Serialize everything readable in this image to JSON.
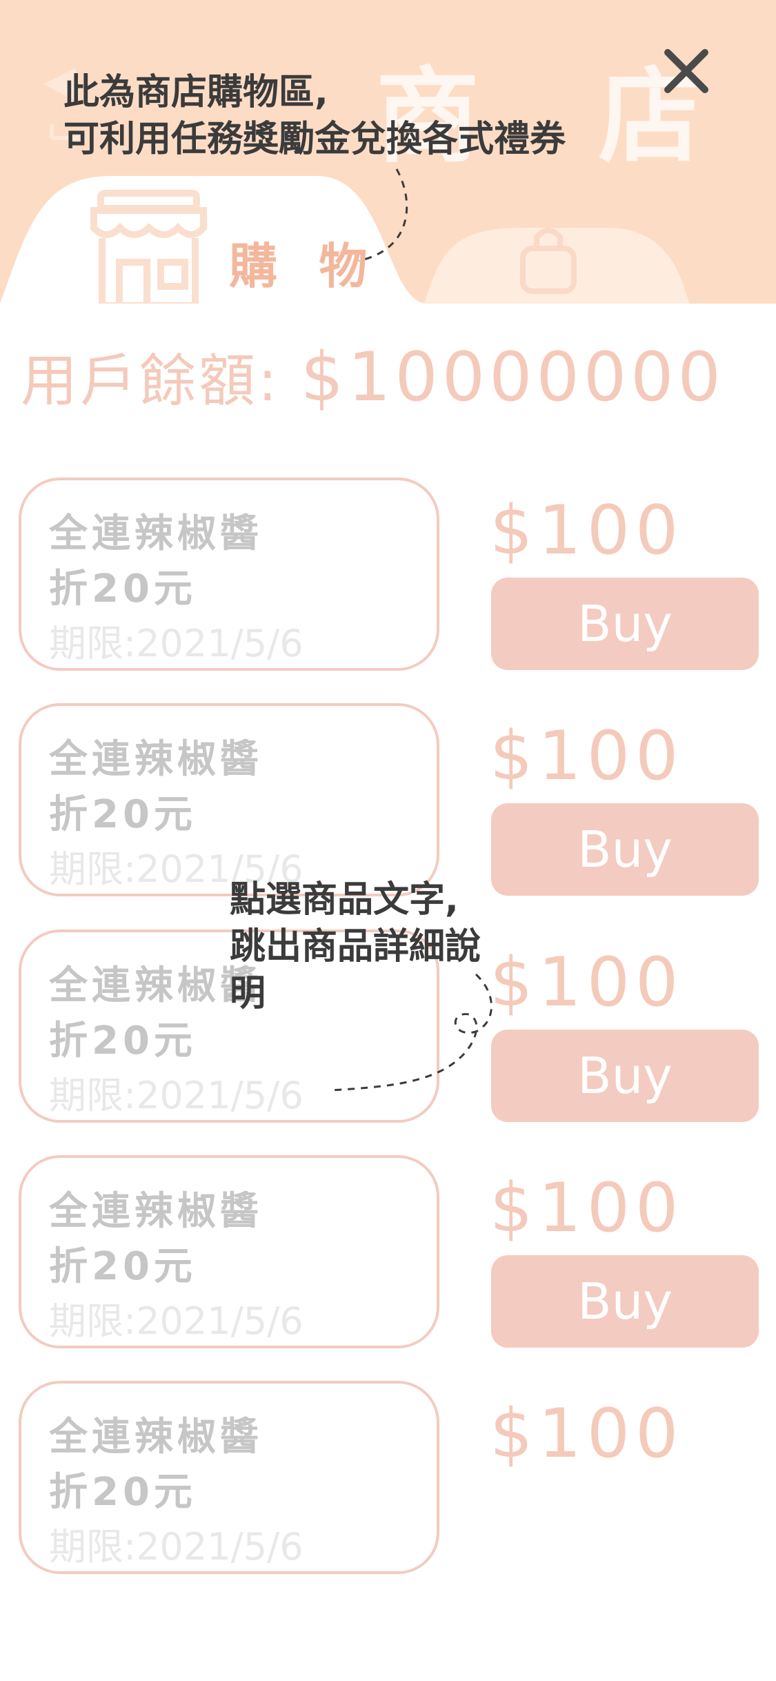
{
  "header": {
    "title": "商 店",
    "tabs": [
      {
        "label": "購 物",
        "icon": "shop-icon"
      },
      {
        "label": "",
        "icon": "bag-icon"
      }
    ]
  },
  "balance": {
    "label": "用戶餘額:",
    "amount": "$10000000"
  },
  "items": [
    {
      "name": "全連辣椒醬",
      "discount": "折20元",
      "expiry": "期限:2021/5/6",
      "price": "$100",
      "buy_label": "Buy"
    },
    {
      "name": "全連辣椒醬",
      "discount": "折20元",
      "expiry": "期限:2021/5/6",
      "price": "$100",
      "buy_label": "Buy"
    },
    {
      "name": "全連辣椒醬",
      "discount": "折20元",
      "expiry": "期限:2021/5/6",
      "price": "$100",
      "buy_label": "Buy"
    },
    {
      "name": "全連辣椒醬",
      "discount": "折20元",
      "expiry": "期限:2021/5/6",
      "price": "$100",
      "buy_label": "Buy"
    },
    {
      "name": "全連辣椒醬",
      "discount": "折20元",
      "expiry": "期限:2021/5/6",
      "price": "$100"
    }
  ],
  "tips": {
    "shop_tip_line1": "此為商店購物區,",
    "shop_tip_line2": "可利用任務獎勵金兌換各式禮券",
    "item_tip_line1": "點選商品文字,",
    "item_tip_line2": "跳出商品詳細說",
    "item_tip_line3": "明"
  },
  "colors": {
    "header_bg": "#fddcc5",
    "accent": "#f4cbc0",
    "tab_label": "#f3b79c",
    "card_text": "#c6c6c6"
  }
}
